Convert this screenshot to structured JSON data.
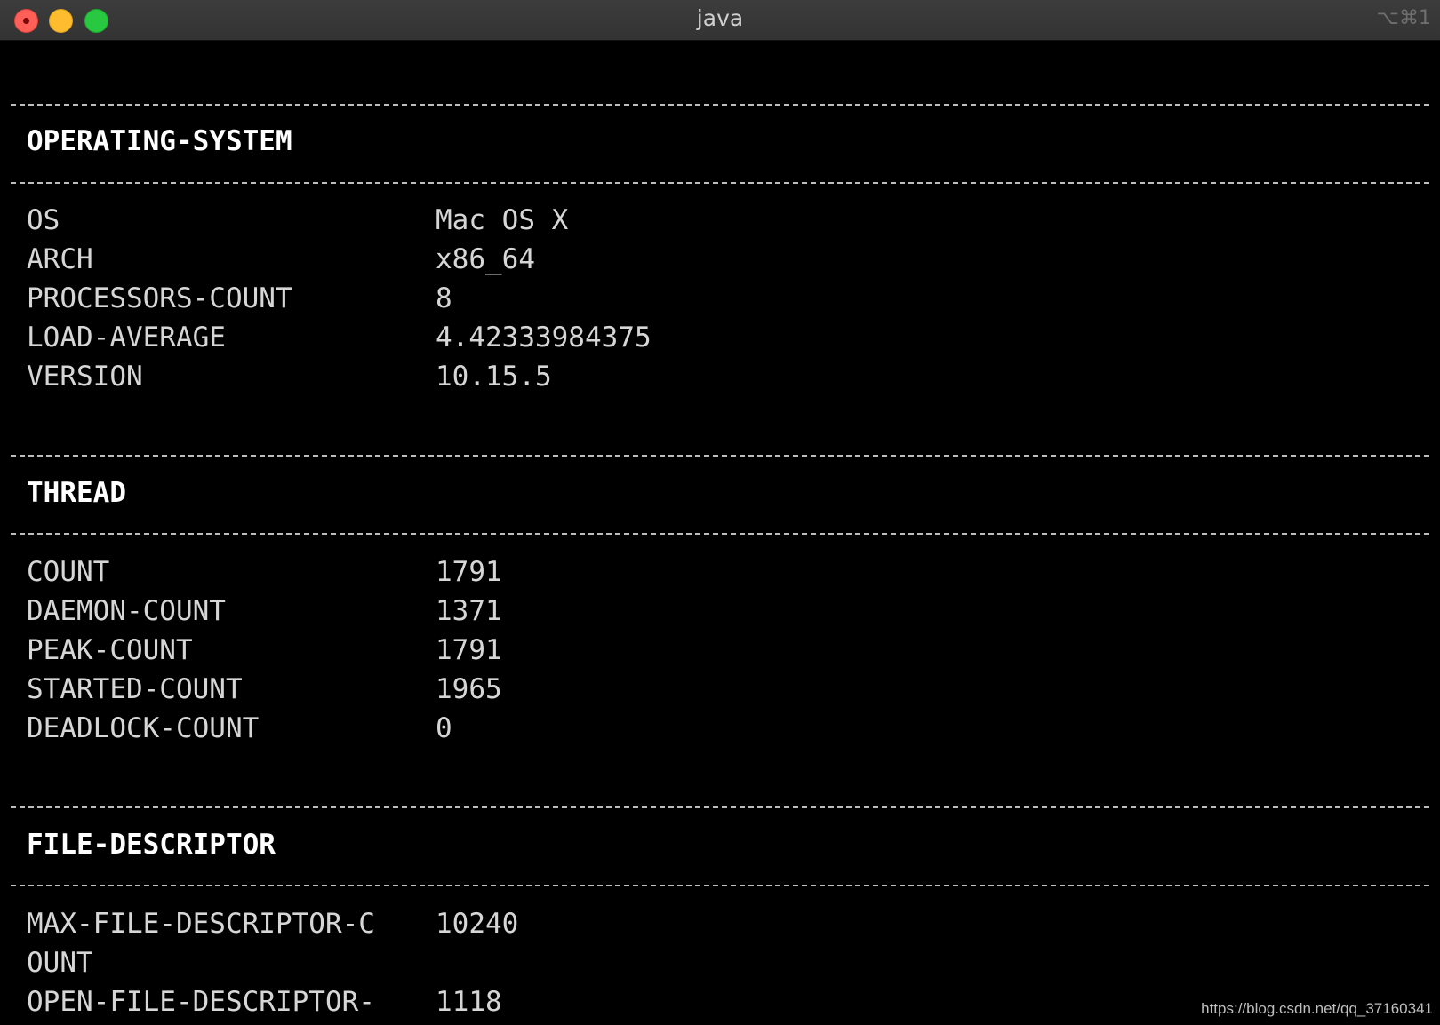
{
  "window": {
    "title": "java",
    "shortcut": "⌥⌘1"
  },
  "sections": [
    {
      "title": "OPERATING-SYSTEM",
      "rows": [
        {
          "key": "OS",
          "value": "Mac OS X"
        },
        {
          "key": "ARCH",
          "value": "x86_64"
        },
        {
          "key": "PROCESSORS-COUNT",
          "value": "8"
        },
        {
          "key": "LOAD-AVERAGE",
          "value": "4.42333984375"
        },
        {
          "key": "VERSION",
          "value": "10.15.5"
        }
      ]
    },
    {
      "title": "THREAD",
      "rows": [
        {
          "key": "COUNT",
          "value": "1791"
        },
        {
          "key": "DAEMON-COUNT",
          "value": "1371"
        },
        {
          "key": "PEAK-COUNT",
          "value": "1791"
        },
        {
          "key": "STARTED-COUNT",
          "value": "1965"
        },
        {
          "key": "DEADLOCK-COUNT",
          "value": "0"
        }
      ]
    },
    {
      "title": "FILE-DESCRIPTOR",
      "rows": [
        {
          "key": "MAX-FILE-DESCRIPTOR-C",
          "value": "10240"
        },
        {
          "key": "OUNT",
          "value": ""
        },
        {
          "key": "OPEN-FILE-DESCRIPTOR-",
          "value": "1118"
        }
      ]
    }
  ],
  "watermark": "https://blog.csdn.net/qq_37160341",
  "colors": {
    "terminal_bg": "#000000",
    "text": "#d6d6d6",
    "close": "#fe5f57",
    "minimize": "#febc2e",
    "maximize": "#28c840"
  }
}
